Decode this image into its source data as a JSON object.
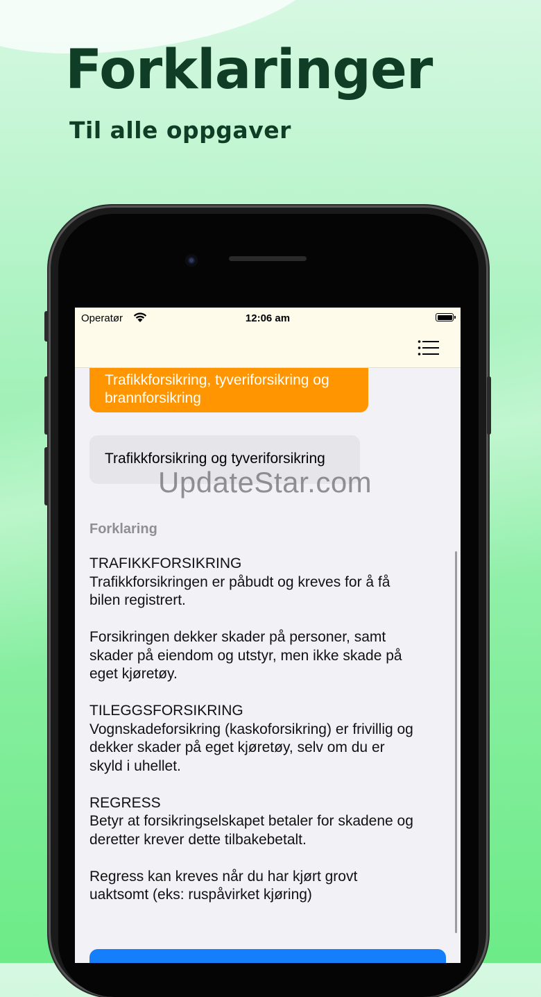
{
  "promo": {
    "title": "Forklaringer",
    "subtitle": "Til alle oppgaver"
  },
  "status_bar": {
    "carrier": "Operatør",
    "time": "12:06 am",
    "battery_level": 1.0
  },
  "nav": {
    "menu_icon": "list-icon"
  },
  "answers": {
    "selected_label": "Trafikkforsikring, tyveriforsikring og brannforsikring",
    "selected_color": "#ff9500",
    "option_label": "Trafikkforsikring og tyveriforsikring"
  },
  "watermark": "UpdateStar.com",
  "explanation": {
    "heading": "Forklaring",
    "paragraphs": [
      [
        "TRAFIKKFORSIKRING",
        "Trafikkforsikringen er påbudt og kreves for å få",
        "bilen registrert."
      ],
      [
        "Forsikringen dekker skader på personer, samt",
        "skader på eiendom og utstyr, men ikke skade på",
        "eget kjøretøy."
      ],
      [
        "TILEGGSFORSIKRING",
        "Vognskadeforsikring (kaskoforsikring) er frivillig og",
        "dekker skader på eget kjøretøy, selv om du er",
        "skyld i uhellet."
      ],
      [
        "REGRESS",
        "Betyr at forsikringselskapet betaler for skadene og",
        "deretter krever dette tilbakebetalt."
      ],
      [
        "Regress kan kreves når du har kjørt grovt",
        "uaktsomt (eks: ruspåvirket kjøring)"
      ]
    ]
  },
  "colors": {
    "headline": "#0f3d26",
    "primary_button": "#147efb",
    "nav_background": "#fffbea"
  }
}
